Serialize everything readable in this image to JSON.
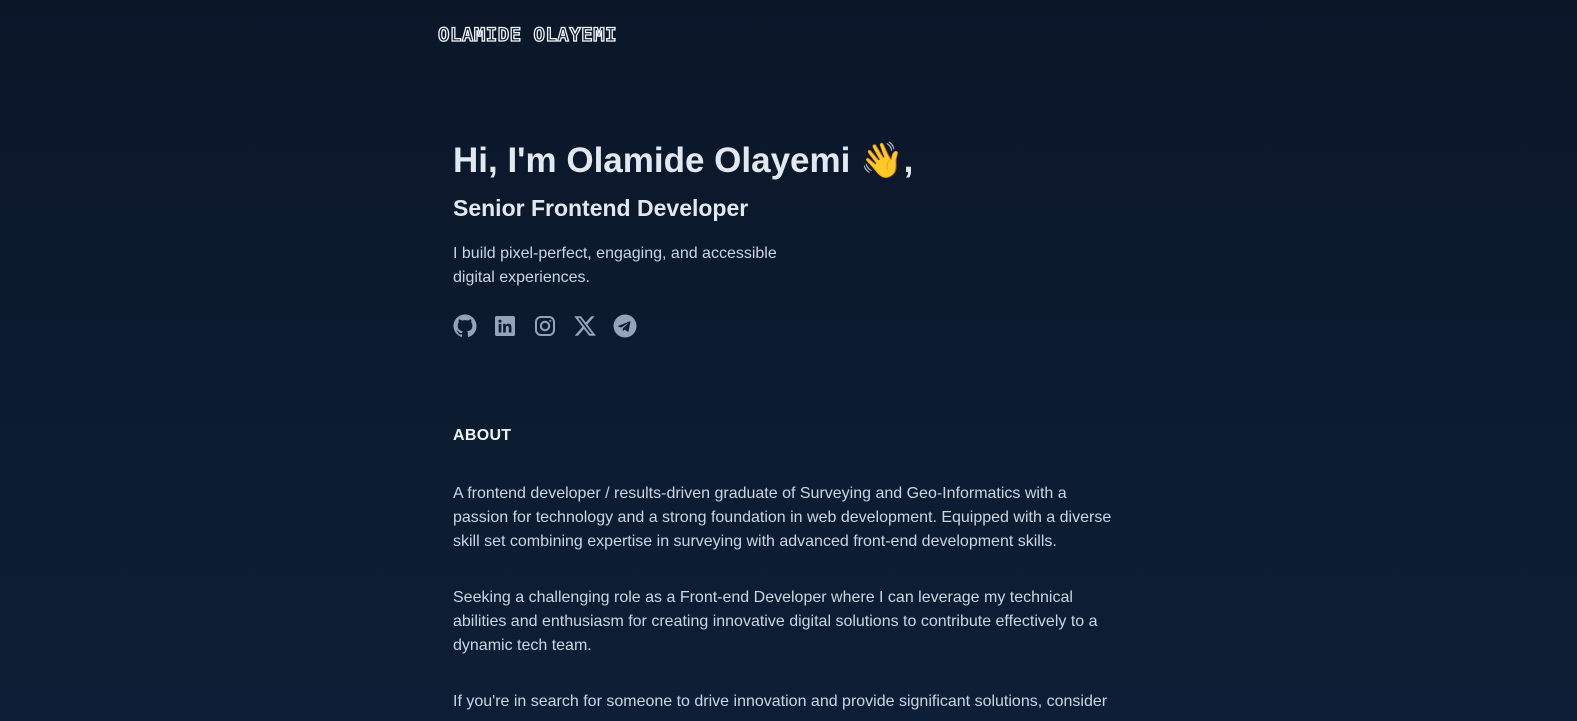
{
  "header": {
    "logo_text": "OLAMIDE OLAYEMI"
  },
  "hero": {
    "greeting": "Hi, I'm Olamide Olayemi 👋,",
    "role": "Senior Frontend Developer",
    "tagline": "I build pixel-perfect, engaging, and accessible digital experiences."
  },
  "socials": [
    {
      "icon": "github-icon"
    },
    {
      "icon": "linkedin-icon"
    },
    {
      "icon": "instagram-icon"
    },
    {
      "icon": "x-icon"
    },
    {
      "icon": "telegram-icon"
    }
  ],
  "about": {
    "heading": "ABOUT",
    "paragraphs": [
      "A frontend developer / results-driven graduate of Surveying and Geo-Informatics with a passion for technology and a strong foundation in web development. Equipped with a diverse skill set combining expertise in surveying with advanced front-end development skills.",
      "Seeking a challenging role as a Front-end Developer where I can leverage my technical abilities and enthusiasm for creating innovative digital solutions to contribute effectively to a dynamic tech team.",
      "If you're in search for someone to drive innovation and provide significant solutions, consider"
    ]
  },
  "colors": {
    "background": "#0b1729",
    "heading": "#e2e8f0",
    "body_text": "#cbd5e1",
    "icon": "#94a3b8"
  }
}
